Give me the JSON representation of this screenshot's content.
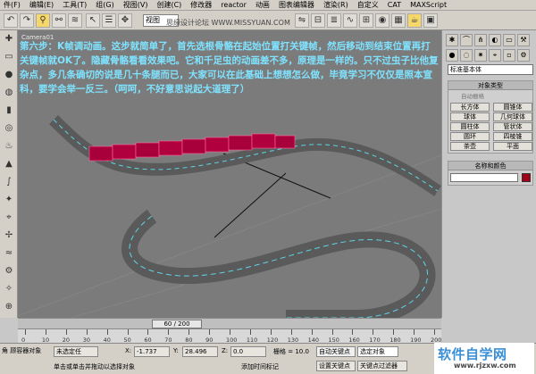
{
  "menubar": {
    "items": [
      "件(F)",
      "编辑(E)",
      "工具(T)",
      "组(G)",
      "视图(V)",
      "创建(C)",
      "修改器",
      "reactor",
      "动画",
      "图表编辑器",
      "渲染(R)",
      "自定义",
      "CAT",
      "MAXScript"
    ]
  },
  "toolbar": {
    "view_select": "视图",
    "watermark": "思缘设计论坛  WWW.MISSYUAN.COM"
  },
  "viewport": {
    "label": "Camera01",
    "caption": "第六步：K帧调动画。这步就简单了，首先选根骨骼在起始位置打关键帧，然后移动到结束位置再打关键帧就OK了。隐藏骨骼看看效果吧。它和千足虫的动画差不多，原理是一样的。只不过虫子比他复杂点，多几条确切的说是几十条腿而已，大家可以在此基础上想想怎么做，毕竟学习不仅仅是照本宣科，要学会举一反三。（呵呵，不好意思说起大道理了）"
  },
  "command_panel": {
    "category_select": "标准基本体",
    "object_type_title": "对象类型",
    "autogrid_label": "自动栅格",
    "object_buttons": [
      "长方体",
      "圆锥体",
      "球体",
      "几何球体",
      "圆柱体",
      "管状体",
      "圆环",
      "四棱锥",
      "茶壶",
      "平面"
    ],
    "name_color_title": "名称和颜色",
    "object_color": "#a00018"
  },
  "timeline": {
    "slider_text": "60 / 200",
    "ticks": [
      "0",
      "10",
      "20",
      "30",
      "40",
      "50",
      "60",
      "70",
      "80",
      "90",
      "100",
      "110",
      "120",
      "130",
      "140",
      "150",
      "160",
      "170",
      "180",
      "190",
      "200"
    ]
  },
  "statusbar": {
    "left_label": "角 顾容器对象",
    "selected_label": "未选定任",
    "x_label": "X:",
    "x_value": "-1.737",
    "y_label": "Y:",
    "y_value": "28.496",
    "z_label": "Z:",
    "z_value": "0.0",
    "grid_label": "栅格 = 10.0",
    "autokey_label": "自动关键点",
    "set_key_label": "设置关键点",
    "selected_object": "选定对象",
    "key_filter": "关键点过滤器",
    "prompt": "单击或单击并拖动以选择对象",
    "add_time_tag": "添加时间标记"
  },
  "logo": {
    "main": "软件自学网",
    "sub": "www.rjzxw.com"
  }
}
